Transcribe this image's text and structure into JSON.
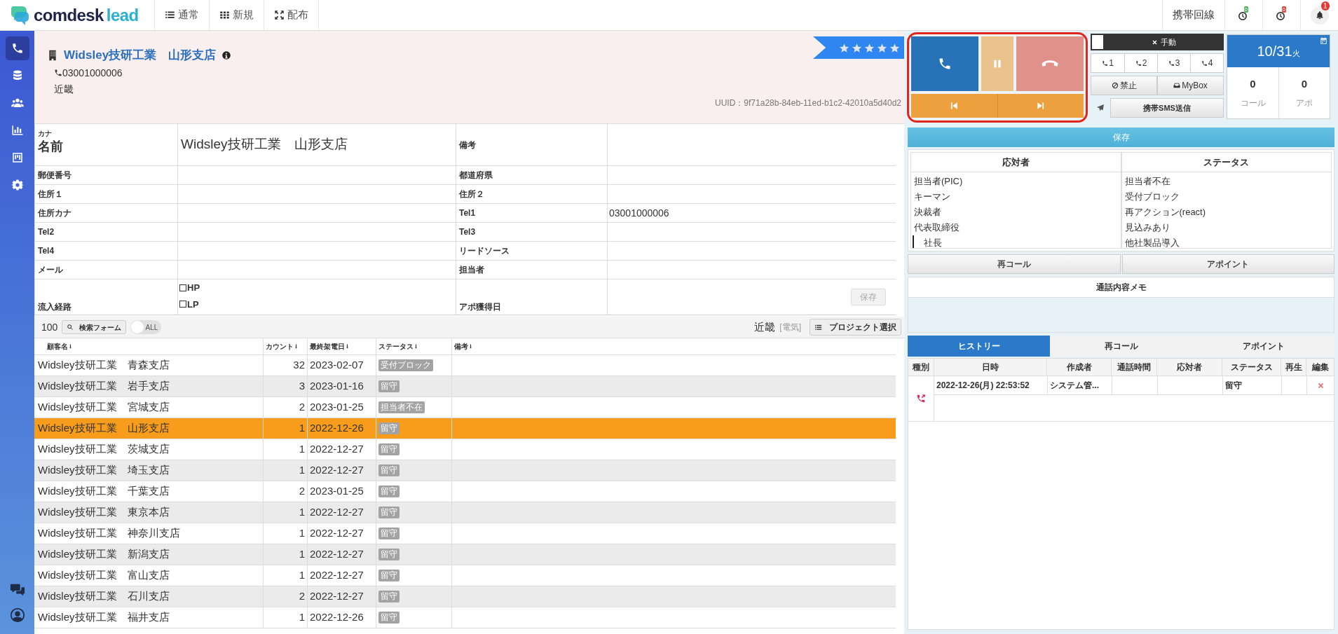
{
  "brand": {
    "name": "comdesk",
    "suffix": "lead"
  },
  "nav_tabs": [
    {
      "kind": "list",
      "label": "通常"
    },
    {
      "kind": "grid",
      "label": "新規"
    },
    {
      "kind": "expand",
      "label": "配布"
    }
  ],
  "top_right": {
    "line_label": "携帯回線",
    "timers": [
      {
        "count": "0",
        "color": "#4caf50"
      },
      {
        "count": "0",
        "color": "#e53935"
      }
    ],
    "notifications": "1"
  },
  "sidebar": {
    "items": [
      {
        "kind": "phone",
        "selected": true
      },
      {
        "kind": "database",
        "selected": false
      },
      {
        "kind": "users",
        "selected": false
      },
      {
        "kind": "chart",
        "selected": false
      },
      {
        "kind": "board",
        "selected": false
      },
      {
        "kind": "settings",
        "selected": false
      }
    ],
    "bottom": [
      {
        "kind": "help"
      },
      {
        "kind": "account"
      }
    ]
  },
  "header": {
    "company": "Widsley技研工業　山形支店",
    "phone": "03001000006",
    "region": "近畿",
    "stars": 5,
    "uuid": "UUID：9f71a28b-84eb-11ed-b1c2-42010a5d40d2"
  },
  "line_panel": {
    "manual": {
      "label": "手動",
      "checked": false
    },
    "lines": [
      "1",
      "2",
      "3",
      "4"
    ],
    "block": "禁止",
    "mybox": "MyBox",
    "sms": "携帯SMS送信"
  },
  "date_card": {
    "date": "10/31",
    "weekday": "火",
    "stats": [
      {
        "value": "0",
        "label": "コール"
      },
      {
        "value": "0",
        "label": "アポ"
      }
    ]
  },
  "form": {
    "rows": [
      {
        "fields": [
          {
            "kind": "name",
            "kana": "カナ",
            "label": "名前",
            "value": "Widsley技研工業　山形支店"
          },
          {
            "kind": "textarea",
            "label": "備考"
          }
        ]
      },
      {
        "fields": [
          {
            "kind": "text",
            "label": "郵便番号"
          },
          {
            "kind": "text",
            "label": "都道府県"
          }
        ]
      },
      {
        "fields": [
          {
            "kind": "text",
            "label": "住所１"
          },
          {
            "kind": "text",
            "label": "住所２"
          }
        ]
      },
      {
        "fields": [
          {
            "kind": "text",
            "label": "住所カナ"
          },
          {
            "kind": "text",
            "label": "Tel1",
            "value": "03001000006"
          }
        ]
      },
      {
        "fields": [
          {
            "kind": "text",
            "label": "Tel2"
          },
          {
            "kind": "text",
            "label": "Tel3"
          }
        ]
      },
      {
        "fields": [
          {
            "kind": "text",
            "label": "Tel4"
          },
          {
            "kind": "text",
            "label": "リードソース"
          }
        ]
      },
      {
        "fields": [
          {
            "kind": "text",
            "label": "メール"
          },
          {
            "kind": "text",
            "label": "担当者"
          }
        ]
      },
      {
        "fields": [
          {
            "kind": "checkboxes",
            "label": "流入経路",
            "options": [
              {
                "label": "HP",
                "checked": false
              },
              {
                "label": "LP",
                "checked": false
              }
            ]
          },
          {
            "kind": "date",
            "label": "アポ獲得日",
            "button": {
              "label": "保存",
              "disabled": true
            }
          }
        ]
      }
    ]
  },
  "list_toolbar": {
    "count": "100",
    "search": "検索フォーム",
    "toggle": {
      "label": "ALL",
      "on": false
    },
    "region": "近畿",
    "category": "[電気]",
    "project_button": "プロジェクト選択"
  },
  "customer_table": {
    "columns": [
      "顧客名",
      "カウント",
      "最終架電日",
      "ステータス",
      "備考"
    ],
    "rows": [
      {
        "name": "Widsley技研工業　青森支店",
        "count": "32",
        "date": "2023-02-07",
        "status": "受付ブロック",
        "selected": false
      },
      {
        "name": "Widsley技研工業　岩手支店",
        "count": "3",
        "date": "2023-01-16",
        "status": "留守",
        "selected": false
      },
      {
        "name": "Widsley技研工業　宮城支店",
        "count": "2",
        "date": "2023-01-25",
        "status": "担当者不在",
        "selected": false
      },
      {
        "name": "Widsley技研工業　山形支店",
        "count": "1",
        "date": "2022-12-26",
        "status": "留守",
        "selected": true
      },
      {
        "name": "Widsley技研工業　茨城支店",
        "count": "1",
        "date": "2022-12-27",
        "status": "留守",
        "selected": false
      },
      {
        "name": "Widsley技研工業　埼玉支店",
        "count": "1",
        "date": "2022-12-27",
        "status": "留守",
        "selected": false
      },
      {
        "name": "Widsley技研工業　千葉支店",
        "count": "2",
        "date": "2023-01-25",
        "status": "留守",
        "selected": false
      },
      {
        "name": "Widsley技研工業　東京本店",
        "count": "1",
        "date": "2022-12-27",
        "status": "留守",
        "selected": false
      },
      {
        "name": "Widsley技研工業　神奈川支店",
        "count": "1",
        "date": "2022-12-27",
        "status": "留守",
        "selected": false
      },
      {
        "name": "Widsley技研工業　新潟支店",
        "count": "1",
        "date": "2022-12-27",
        "status": "留守",
        "selected": false
      },
      {
        "name": "Widsley技研工業　富山支店",
        "count": "1",
        "date": "2022-12-27",
        "status": "留守",
        "selected": false
      },
      {
        "name": "Widsley技研工業　石川支店",
        "count": "2",
        "date": "2022-12-27",
        "status": "留守",
        "selected": false
      },
      {
        "name": "Widsley技研工業　福井支店",
        "count": "1",
        "date": "2022-12-26",
        "status": "留守",
        "selected": false
      }
    ]
  },
  "result_panel": {
    "save": "保存",
    "responders": {
      "title": "応対者",
      "items": [
        {
          "label": "担当者(PIC)"
        },
        {
          "label": "キーマン"
        },
        {
          "label": "決裁者"
        },
        {
          "label": "代表取締役",
          "children": [
            {
              "label": "社長"
            }
          ]
        }
      ]
    },
    "statuses": {
      "title": "ステータス",
      "items": [
        {
          "label": "担当者不在"
        },
        {
          "label": "受付ブロック"
        },
        {
          "label": "再アクション(react)"
        },
        {
          "label": "見込みあり"
        },
        {
          "label": "他社製品導入"
        }
      ]
    },
    "buttons": [
      "再コール",
      "アポイント"
    ],
    "memo_title": "通話内容メモ"
  },
  "history": {
    "tabs": [
      {
        "label": "ヒストリー",
        "selected": true
      },
      {
        "label": "再コール",
        "selected": false
      },
      {
        "label": "アポイント",
        "selected": false
      }
    ],
    "columns": [
      "種別",
      "日時",
      "作成者",
      "通話時間",
      "応対者",
      "ステータス",
      "再生",
      "編集"
    ],
    "rows": [
      {
        "kind": "outgoing",
        "datetime": "2022-12-26(月) 22:53:52",
        "author": "システム管...",
        "status": "留守"
      }
    ]
  }
}
